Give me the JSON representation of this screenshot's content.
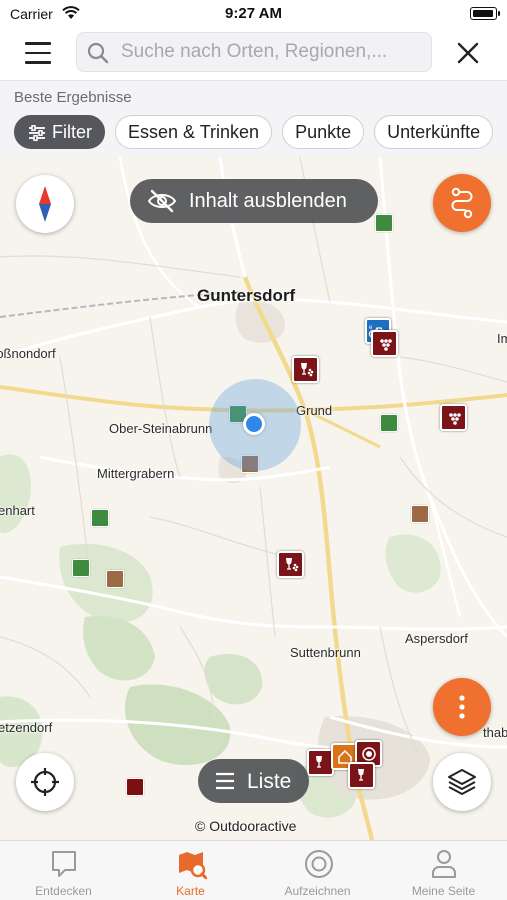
{
  "status_bar": {
    "carrier": "Carrier",
    "time": "9:27 AM"
  },
  "header": {
    "search_placeholder": "Suche nach Orten, Regionen,...",
    "menu_icon": "hamburger-menu-icon",
    "close_icon": "close-icon"
  },
  "filters": {
    "section_label": "Beste Ergebnisse",
    "chips": [
      "Filter",
      "Essen & Trinken",
      "Punkte",
      "Unterkünfte"
    ]
  },
  "map": {
    "hide_content_label": "Inhalt ausblenden",
    "list_label": "Liste",
    "attribution": "© Outdooractive",
    "places": [
      "Guntersdorf",
      "Großnondorf",
      "Ober-Steinabrunn",
      "Grund",
      "Mittergrabern",
      "Hart",
      "Sutten­brunn",
      "Aspersdorf",
      "Kleinstetteldorf",
      "Immendorf",
      "Hollabrunn"
    ]
  },
  "tabs": [
    {
      "label": "Entdecken",
      "icon": "discover-icon"
    },
    {
      "label": "Karte",
      "icon": "map-icon"
    },
    {
      "label": "Aufzeichnen",
      "icon": "record-icon"
    },
    {
      "label": "Meine Seite",
      "icon": "profile-icon"
    }
  ],
  "colors": {
    "accent": "#e8692a",
    "orange_button": "#f07030",
    "wine_poi": "#7a1418",
    "location": "#2f88e8"
  }
}
